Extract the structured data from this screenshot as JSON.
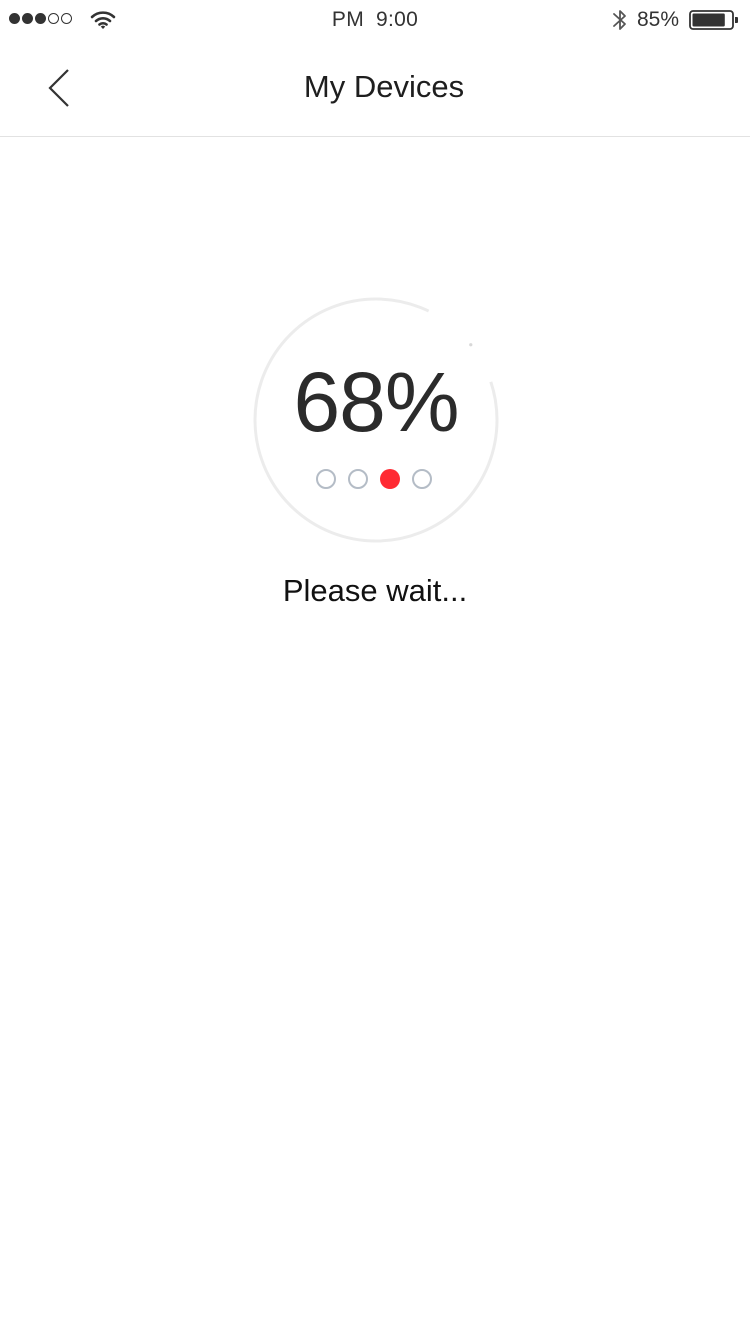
{
  "status_bar": {
    "ampm": "PM",
    "time": "9:00",
    "battery_text": "85%",
    "signal_bars_filled": 3,
    "signal_bars_total": 5,
    "battery_level": 0.85
  },
  "nav": {
    "title": "My Devices",
    "back_icon": "chevron-left-icon"
  },
  "progress": {
    "value_text": "68%",
    "value": 68,
    "active_step": 3,
    "total_steps": 4,
    "status_text": "Please wait..."
  },
  "colors": {
    "accent": "#ff2a33",
    "inactive_dot": "#b4bcc6",
    "ring": "#ececec"
  }
}
